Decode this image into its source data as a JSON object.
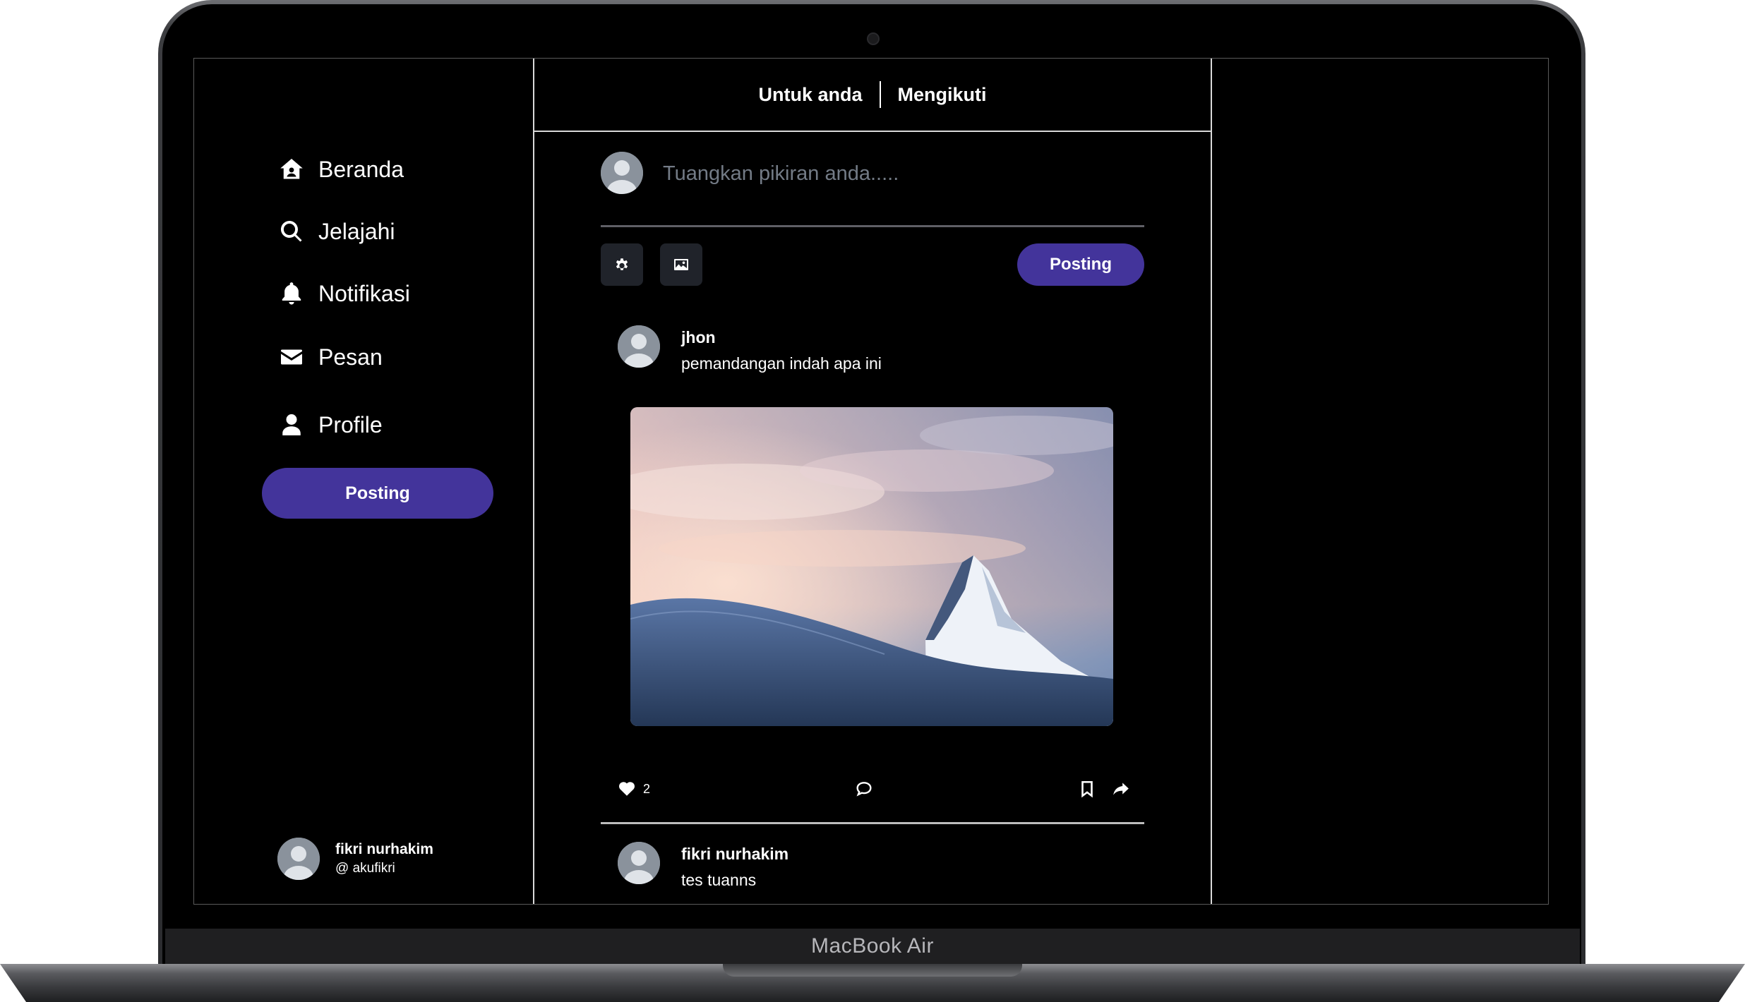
{
  "device": {
    "label": "MacBook Air"
  },
  "sidebar": {
    "items": [
      {
        "label": "Beranda",
        "icon": "home-icon"
      },
      {
        "label": "Jelajahi",
        "icon": "search-icon"
      },
      {
        "label": "Notifikasi",
        "icon": "bell-icon"
      },
      {
        "label": "Pesan",
        "icon": "envelope-icon"
      },
      {
        "label": "Profile",
        "icon": "user-icon"
      }
    ],
    "post_button": "Posting",
    "user": {
      "name": "fikri nurhakim",
      "handle": "@ akufikri"
    }
  },
  "tabs": [
    {
      "label": "Untuk anda"
    },
    {
      "label": "Mengikuti"
    }
  ],
  "composer": {
    "placeholder": "Tuangkan pikiran anda.....",
    "tools": [
      "gear-icon",
      "image-icon"
    ],
    "post_button": "Posting"
  },
  "feed": {
    "posts": [
      {
        "author": "jhon",
        "text": "pemandangan indah apa ini",
        "image": "mountain-sunset-photo",
        "likes": "2"
      },
      {
        "author": "fikri nurhakim",
        "text": "tes tuanns"
      }
    ]
  },
  "colors": {
    "accent": "#43349b",
    "background": "#000000",
    "text": "#ffffff",
    "placeholder": "#737b86",
    "tool_button_bg": "#20232a"
  }
}
